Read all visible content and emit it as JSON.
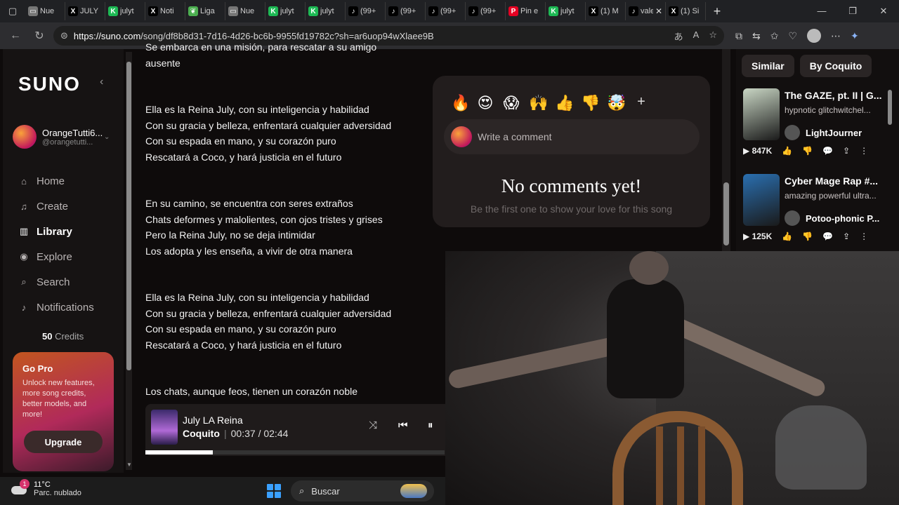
{
  "browser": {
    "tabs": [
      {
        "label": "Nue",
        "fav": "doc",
        "color": "#777"
      },
      {
        "label": "JULY",
        "fav": "X",
        "color": "#000"
      },
      {
        "label": "julyt",
        "fav": "K",
        "color": "#1db954"
      },
      {
        "label": "Noti",
        "fav": "X",
        "color": "#000"
      },
      {
        "label": "Liga",
        "fav": "leaf",
        "color": "#4caf50"
      },
      {
        "label": "Nue",
        "fav": "doc",
        "color": "#777"
      },
      {
        "label": "julyt",
        "fav": "K",
        "color": "#1db954"
      },
      {
        "label": "julyt",
        "fav": "K",
        "color": "#1db954"
      },
      {
        "label": "(99+",
        "fav": "tiktok",
        "color": "#000"
      },
      {
        "label": "(99+",
        "fav": "tiktok",
        "color": "#000"
      },
      {
        "label": "(99+",
        "fav": "tiktok",
        "color": "#000"
      },
      {
        "label": "(99+",
        "fav": "tiktok",
        "color": "#000"
      },
      {
        "label": "Pin e",
        "fav": "P",
        "color": "#e60023"
      },
      {
        "label": "julyt",
        "fav": "K",
        "color": "#1db954"
      },
      {
        "label": "(1) M",
        "fav": "X",
        "color": "#000"
      },
      {
        "label": "valer",
        "fav": "tiktok",
        "color": "#000"
      },
      {
        "label": "(1) Si",
        "fav": "X",
        "color": "#000"
      }
    ],
    "url_host": "https://suno.com",
    "url_path": "/song/df8b8d31-7d16-4d26-bc6b-9955fd19782c?sh=ar6uop94wXlaee9B"
  },
  "sidebar": {
    "logo": "SUNO",
    "user_name": "OrangeTutti6...",
    "user_handle": "@orangetutti...",
    "nav": [
      {
        "label": "Home",
        "icon": "home-icon",
        "glyph": "⌂",
        "active": false
      },
      {
        "label": "Create",
        "icon": "create-icon",
        "glyph": "♫",
        "active": false
      },
      {
        "label": "Library",
        "icon": "library-icon",
        "glyph": "▥",
        "active": true
      },
      {
        "label": "Explore",
        "icon": "explore-icon",
        "glyph": "◉",
        "active": false
      },
      {
        "label": "Search",
        "icon": "search-icon",
        "glyph": "⌕",
        "active": false
      },
      {
        "label": "Notifications",
        "icon": "bell-icon",
        "glyph": "♪",
        "active": false
      }
    ],
    "credits_count": "50",
    "credits_label": "Credits",
    "gopro_title": "Go Pro",
    "gopro_text": "Unlock new features, more song credits, better models, and more!",
    "upgrade_label": "Upgrade"
  },
  "lyrics": [
    [
      "Se embarca en una misión, para rescatar a su amigo",
      "ausente"
    ],
    [
      "Ella es la Reina July, con su inteligencia y habilidad",
      "Con su gracia y belleza, enfrentará cualquier adversidad",
      "Con su espada en mano, y su corazón puro",
      "Rescatará a Coco, y hará justicia en el futuro"
    ],
    [
      "En su camino, se encuentra con seres extraños",
      "Chats deformes y malolientes, con ojos tristes y grises",
      "Pero la Reina July, no se deja intimidar",
      "Los adopta y les enseña, a vivir de otra manera"
    ],
    [
      "Ella es la Reina July, con su inteligencia y habilidad",
      "Con su gracia y belleza, enfrentará cualquier adversidad",
      "Con su espada en mano, y su corazón puro",
      "Rescatará a Coco, y hará justicia en el futuro"
    ],
    [
      "Los chats, aunque feos, tienen un corazón noble"
    ]
  ],
  "comments": {
    "emojis": [
      "🔥",
      "😍",
      "😱",
      "🙌",
      "👍",
      "👎",
      "🤯"
    ],
    "placeholder": "Write a comment",
    "empty_title": "No comments yet!",
    "empty_sub": "Be the first one to show your love for this song"
  },
  "player": {
    "title": "July LA Reina",
    "artist": "Coquito",
    "current": "00:37",
    "separator": "/",
    "duration": "02:44",
    "progress_fraction": 0.225
  },
  "right_panel": {
    "tabs": [
      "Similar",
      "By Coquito"
    ],
    "songs": [
      {
        "title": "The GAZE, pt. II | G...",
        "desc": "hypnotic glitchwitchel...",
        "author": "LightJourner",
        "plays": "847K",
        "thumb": "#c9d6c4"
      },
      {
        "title": "Cyber Mage Rap #...",
        "desc": "amazing powerful ultra...",
        "author": "Potoo-phonic P...",
        "plays": "125K",
        "thumb": "#2a6fb0"
      }
    ]
  },
  "taskbar": {
    "temp": "11°C",
    "weather": "Parc. nublado",
    "badge": "1",
    "search": "Buscar"
  }
}
